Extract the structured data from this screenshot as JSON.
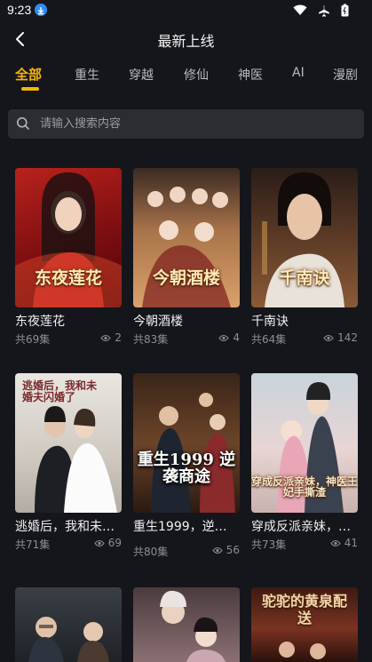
{
  "status": {
    "time": "9:23"
  },
  "header": {
    "title": "最新上线"
  },
  "tabs": [
    "全部",
    "重生",
    "穿越",
    "修仙",
    "神医",
    "AI",
    "漫剧"
  ],
  "search": {
    "placeholder": "请输入搜索内容"
  },
  "dramas": [
    {
      "title": "东夜莲花",
      "poster_text": "东夜莲花",
      "episodes": "共69集",
      "views": "2"
    },
    {
      "title": "今朝酒楼",
      "poster_text": "今朝酒楼",
      "episodes": "共83集",
      "views": "4"
    },
    {
      "title": "千南诀",
      "poster_text": "千南诀",
      "episodes": "共64集",
      "views": "142"
    },
    {
      "title": "逃婚后，我和未…",
      "poster_text": "逃婚后，我和未婚夫闪婚了",
      "episodes": "共71集",
      "views": "69"
    },
    {
      "title": "重生1999，逆…",
      "poster_text": "重生1999 逆袭商途",
      "episodes": "共80集",
      "views": "56"
    },
    {
      "title": "穿成反派亲妹，…",
      "poster_text": "穿成反派亲妹，神医王妃手撕渣",
      "episodes": "共73集",
      "views": "41"
    },
    {
      "title": "",
      "poster_text": "",
      "episodes": "",
      "views": ""
    },
    {
      "title": "",
      "poster_text": "",
      "episodes": "",
      "views": ""
    },
    {
      "title": "",
      "poster_text": "驼驼的黄泉配送",
      "episodes": "",
      "views": ""
    }
  ],
  "colors": {
    "accent": "#f7b500",
    "background": "#15161b",
    "search_bg": "#2c2d33"
  }
}
